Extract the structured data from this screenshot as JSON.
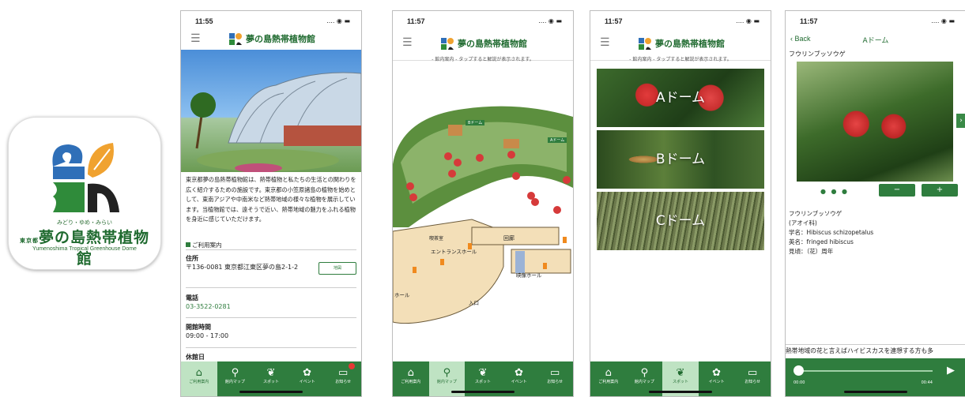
{
  "app_icon": {
    "tagline": "みどり・ゆめ・みらい",
    "title": "夢の島熱帯植物館",
    "title_prefix": "東京都",
    "english": "Yumenoshima Tropical Greenhouse Dome"
  },
  "logo_text": "夢の島熱帯植物館",
  "screens": [
    {
      "time": "11:55",
      "intro": "東京都夢の島熱帯植物館は、熱帯植物と私たちの生活との関わりを広く紹介するための施設です。東京都の小笠原諸島の植物を始めとして、東南アジアや中南米など熱帯地域の様々な植物を展示しています。当植物館では、遠そうで近い、熱帯地域の魅力をふれる植物を身近に感じていただけます。",
      "guide_heading": "ご利用案内",
      "address_label": "住所",
      "address_value": "〒136-0081 東京都江東区夢の島2-1-2",
      "map_button": "地図",
      "phone_label": "電話",
      "phone_value": "03-3522-0281",
      "hours_label": "開館時間",
      "hours_value": "09:00 - 17:00",
      "closed_label": "休館日"
    },
    {
      "time": "11:57",
      "note": "- 館内案内 - タップすると解説が表示されます。",
      "map_labels": {
        "entrance_hall": "エントランスホール",
        "entrance": "入口",
        "event_hall": "映像ホール",
        "tea_room": "喫茶室",
        "corridor": "回廊",
        "hall": "ホール",
        "b_dome": "Bドーム",
        "a_dome": "Aドーム"
      }
    },
    {
      "time": "11:57",
      "note": "- 館内案内 - タップすると解説が表示されます。",
      "domes": [
        "Aドーム",
        "Bドーム",
        "Cドーム"
      ]
    },
    {
      "time": "11:57",
      "back": "Back",
      "nav_title": "Aドーム",
      "plant_name": "フウリンブッソウゲ",
      "minus": "−",
      "plus": "+",
      "desc": [
        "フウリンブッソウゲ",
        "(アオイ科)",
        "学名：Hibiscus schizopetalus",
        "英名：fringed hibiscus",
        "見頃：（花）周年"
      ],
      "marquee": "熱帯地域の花と言えばハイビスカスを連想する方も多",
      "time_start": "00:00",
      "time_end": "00:44"
    }
  ],
  "tabs": [
    "ご利用案内",
    "館内マップ",
    "スポット",
    "イベント",
    "お知らせ"
  ],
  "colors": {
    "brand_green": "#2f7d3e",
    "badge_red": "#e53935"
  }
}
